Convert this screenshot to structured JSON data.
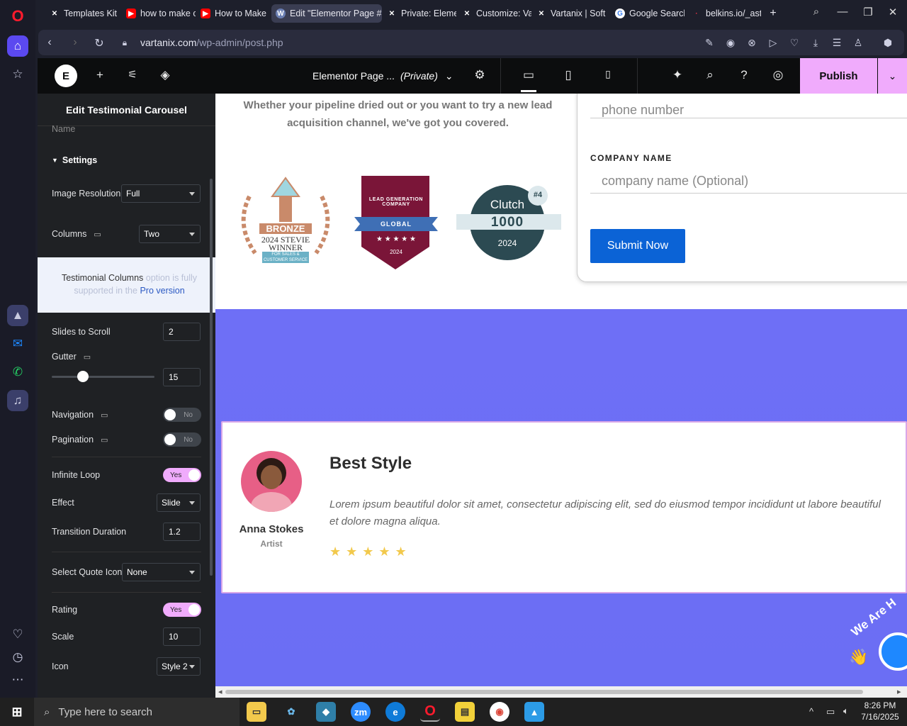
{
  "browser": {
    "tabs": [
      {
        "label": "Templates Kit",
        "icon": "elementor-x-icon"
      },
      {
        "label": "how to make c",
        "icon": "youtube-icon"
      },
      {
        "label": "How to Make",
        "icon": "youtube-icon"
      },
      {
        "label": "Edit \"Elementor Page #1",
        "icon": "wordpress-icon",
        "active": true
      },
      {
        "label": "Private: Elemen",
        "icon": "elementor-x-icon"
      },
      {
        "label": "Customize: Va",
        "icon": "elementor-x-icon"
      },
      {
        "label": "Vartanix | Soft",
        "icon": "elementor-x-icon"
      },
      {
        "label": "Google Search",
        "icon": "google-icon"
      },
      {
        "label": "belkins.io/_ast",
        "icon": "belkins-icon"
      }
    ],
    "url_domain": "vartanix.com",
    "url_path": "/wp-admin/post.php"
  },
  "editor": {
    "doc_title": "Elementor Page ...",
    "doc_status": "(Private)",
    "publish_label": "Publish"
  },
  "panel": {
    "title": "Edit Testimonial Carousel",
    "cut_label": "Name",
    "section_label": "Settings",
    "image_resolution_label": "Image Resolution",
    "image_resolution_value": "Full",
    "columns_label": "Columns",
    "columns_value": "Two",
    "notice_text_a": "Testimonial Columns",
    "notice_text_b": " option is fully supported in the ",
    "notice_link": "Pro version",
    "slides_to_scroll_label": "Slides to Scroll",
    "slides_to_scroll_value": "2",
    "gutter_label": "Gutter",
    "gutter_value": "15",
    "gutter_fraction": 0.3,
    "navigation_label": "Navigation",
    "navigation_value": "No",
    "pagination_label": "Pagination",
    "pagination_value": "No",
    "infinite_loop_label": "Infinite Loop",
    "infinite_loop_value": "Yes",
    "effect_label": "Effect",
    "effect_value": "Slide",
    "transition_label": "Transition Duration",
    "transition_value": "1.2",
    "quote_icon_label": "Select Quote Icon",
    "quote_icon_value": "None",
    "rating_label": "Rating",
    "rating_value": "Yes",
    "scale_label": "Scale",
    "scale_value": "10",
    "icon_label": "Icon",
    "icon_value": "Style 2"
  },
  "page": {
    "intro": "Whether your pipeline dried out or you want to try a new lead acquisition channel, we've got you covered.",
    "phone_placeholder": "phone number",
    "company_label": "COMPANY NAME",
    "company_placeholder": "company name (Optional)",
    "submit_label": "Submit Now",
    "badges": {
      "stevie_top": "BRONZE",
      "stevie_mid": "2024 STEVIE",
      "stevie_win": "WINNER",
      "stevie_sub": "FOR SALES & CUSTOMER SERVICE",
      "leadgen_top": "LEAD GENERATION COMPANY",
      "leadgen_ribbon": "GLOBAL",
      "leadgen_year": "2024",
      "clutch_name": "Clutch",
      "clutch_rank": "#4",
      "clutch_num": "1000",
      "clutch_year": "2024"
    },
    "testimonial": {
      "name": "Anna Stokes",
      "role": "Artist",
      "heading": "Best Style",
      "body": "Lorem ipsum beautiful dolor sit amet, consectetur adipiscing elit, sed do eiusmod tempor incididunt ut labore beautiful et dolore magna aliqua.",
      "stars": "★ ★ ★ ★ ★",
      "rating": 5
    },
    "badge_text": "We Are H"
  },
  "taskbar": {
    "search_placeholder": "Type here to search",
    "time": "8:26 PM",
    "date": "7/16/2025"
  },
  "colors": {
    "accent": "#f0abfc",
    "band": "#6e6ff6",
    "submit": "#0b63d6",
    "star": "#f2c94c"
  }
}
